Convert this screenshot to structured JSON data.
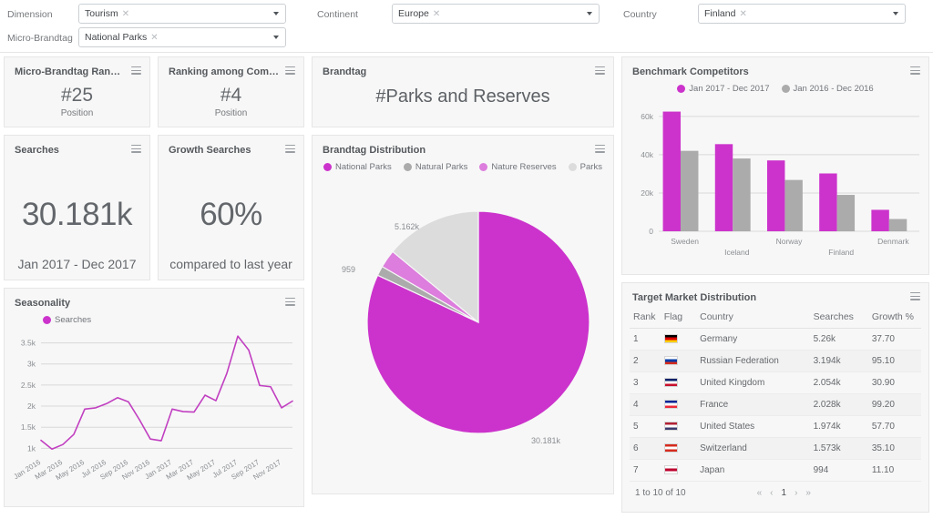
{
  "filters": {
    "rows": [
      {
        "label": "Dimension",
        "value": "Tourism",
        "name": "dimension"
      },
      {
        "label": "Micro-Brandtag",
        "value": "National Parks",
        "name": "micro-brandtag"
      },
      {
        "label": "Continent",
        "value": "Europe",
        "name": "continent"
      },
      {
        "label": "Country",
        "value": "Finland",
        "name": "country"
      }
    ],
    "remove_glyph": "✕"
  },
  "colors": {
    "accent": "#cc33cc",
    "accent_light": "#dd7ddd",
    "gray": "#ababab",
    "gray_light": "#dcdcdc",
    "line": "#c13fc1"
  },
  "kpi": {
    "micro_ranking": {
      "title": "Micro-Brandtag Ranking ...",
      "value": "#25",
      "sub": "Position"
    },
    "competitor_ranking": {
      "title": "Ranking among Competito...",
      "value": "#4",
      "sub": "Position"
    },
    "searches": {
      "title": "Searches",
      "value": "30.181k",
      "sub": "Jan 2017 - Dec 2017"
    },
    "growth": {
      "title": "Growth Searches",
      "value": "60%",
      "sub": "compared to last year"
    }
  },
  "brandtag": {
    "title": "Brandtag",
    "value": "#Parks and Reserves"
  },
  "chart_data": [
    {
      "id": "brandtag-distribution",
      "type": "pie",
      "title": "Brandtag Distribution",
      "legend_position": "top",
      "categories": [
        "National Parks",
        "Natural Parks",
        "Nature Reserves",
        "Parks"
      ],
      "values": [
        30181,
        520,
        959,
        5162
      ],
      "value_labels": [
        "30.181k",
        "",
        "959",
        "5.162k"
      ],
      "colors": [
        "#cc33cc",
        "#ababab",
        "#dd7ddd",
        "#dcdcdc"
      ],
      "annotations": [
        {
          "text": "5.162k",
          "slice": "Parks"
        },
        {
          "text": "959",
          "slice": "Nature Reserves"
        },
        {
          "text": "30.181k",
          "slice": "National Parks"
        }
      ]
    },
    {
      "id": "benchmark-competitors",
      "type": "bar",
      "title": "Benchmark Competitors",
      "categories": [
        "Sweden",
        "Iceland",
        "Norway",
        "Finland",
        "Denmark"
      ],
      "series": [
        {
          "name": "Jan 2017 - Dec 2017",
          "color": "#cc33cc",
          "values": [
            62500,
            45500,
            37000,
            30200,
            11200
          ]
        },
        {
          "name": "Jan 2016 - Dec 2016",
          "color": "#ababab",
          "values": [
            42000,
            38000,
            26800,
            19000,
            6400
          ]
        }
      ],
      "ylabel": "",
      "xlabel": "",
      "ylim": [
        0,
        68000
      ],
      "yticks": [
        0,
        20000,
        40000,
        60000
      ],
      "ytick_labels": [
        "0",
        "20k",
        "40k",
        "60k"
      ],
      "grid": true,
      "legend_position": "top"
    },
    {
      "id": "seasonality",
      "type": "line",
      "title": "Seasonality",
      "legend_position": "top",
      "series": [
        {
          "name": "Searches",
          "color": "#c13fc1",
          "values": [
            1190,
            980,
            1090,
            1330,
            1930,
            1960,
            2060,
            2200,
            2100,
            1680,
            1220,
            1180,
            1930,
            1870,
            1860,
            2260,
            2130,
            2780,
            3660,
            3330,
            2490,
            2460,
            1960,
            2120
          ]
        }
      ],
      "x": [
        "Jan 2016",
        "Feb 2016",
        "Mar 2016",
        "Apr 2016",
        "May 2016",
        "Jun 2016",
        "Jul 2016",
        "Aug 2016",
        "Sep 2016",
        "Oct 2016",
        "Nov 2016",
        "Dec 2016",
        "Jan 2017",
        "Feb 2017",
        "Mar 2017",
        "Apr 2017",
        "May 2017",
        "Jun 2017",
        "Jul 2017",
        "Aug 2017",
        "Sep 2017",
        "Oct 2017",
        "Nov 2017",
        "Dec 2017"
      ],
      "xtick_labels": [
        "Jan 2016",
        "Mar 2016",
        "May 2016",
        "Jul 2016",
        "Sep 2016",
        "Nov 2016",
        "Jan 2017",
        "Mar 2017",
        "May 2017",
        "Jul 2017",
        "Sep 2017",
        "Nov 2017"
      ],
      "ylim": [
        900,
        3750
      ],
      "yticks": [
        1000,
        1500,
        2000,
        2500,
        3000,
        3500
      ],
      "ytick_labels": [
        "1k",
        "1.5k",
        "2k",
        "2.5k",
        "3k",
        "3.5k"
      ],
      "grid": true
    }
  ],
  "table": {
    "title": "Target Market Distribution",
    "columns": [
      "Rank",
      "Flag",
      "Country",
      "Searches",
      "Growth %"
    ],
    "rows": [
      {
        "rank": "1",
        "country": "Germany",
        "searches": "5.26k",
        "growth": "37.70",
        "flag": [
          "#000000",
          "#dd0000",
          "#ffce00"
        ]
      },
      {
        "rank": "2",
        "country": "Russian Federation",
        "searches": "3.194k",
        "growth": "95.10",
        "flag": [
          "#ffffff",
          "#0039a6",
          "#d52b1e"
        ]
      },
      {
        "rank": "3",
        "country": "United Kingdom",
        "searches": "2.054k",
        "growth": "30.90",
        "flag": [
          "#012169",
          "#ffffff",
          "#c8102e"
        ]
      },
      {
        "rank": "4",
        "country": "France",
        "searches": "2.028k",
        "growth": "99.20",
        "flag": [
          "#002395",
          "#ffffff",
          "#ed2939"
        ]
      },
      {
        "rank": "5",
        "country": "United States",
        "searches": "1.974k",
        "growth": "57.70",
        "flag": [
          "#b22234",
          "#ffffff",
          "#3c3b6e"
        ]
      },
      {
        "rank": "6",
        "country": "Switzerland",
        "searches": "1.573k",
        "growth": "35.10",
        "flag": [
          "#d52b1e",
          "#ffffff",
          "#d52b1e"
        ]
      },
      {
        "rank": "7",
        "country": "Japan",
        "searches": "994",
        "growth": "11.10",
        "flag": [
          "#ffffff",
          "#bc002d",
          "#ffffff"
        ]
      }
    ],
    "footer_text": "1 to 10 of 10",
    "pager": [
      "«",
      "‹",
      "1",
      "›",
      "»"
    ],
    "pager_current": "1"
  }
}
